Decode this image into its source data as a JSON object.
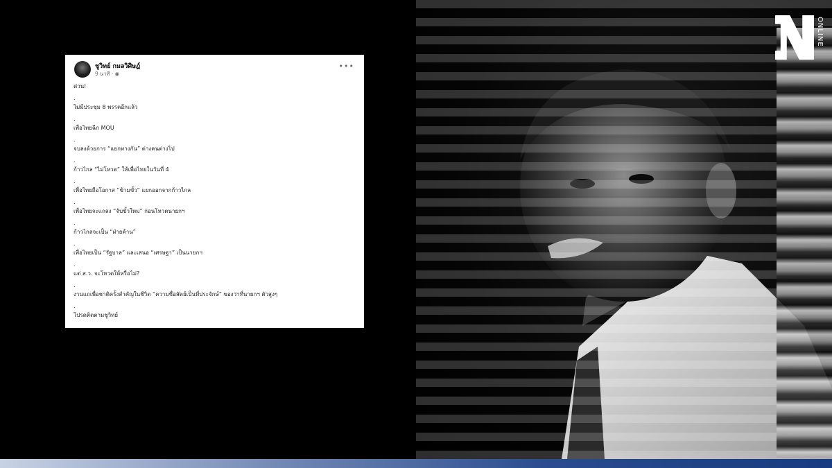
{
  "logo": {
    "brand_letter": "N",
    "brand_text": "ONLINE"
  },
  "post": {
    "author": "ชูวิทย์ กมลวิศิษฏ์",
    "meta": "9 นาที · ",
    "globe_icon": "globe-icon",
    "more_icon": "more-options-icon",
    "separator": ".",
    "lines": [
      "ด่วน!",
      "ไม่มีประชุม 8 พรรคอีกแล้ว",
      "เพื่อไทยฉีก MOU",
      "จบลงด้วยการ “แยกทางกัน” ต่างคนต่างไป",
      "ก้าวไกล “ไม่โหวต” ให้เพื่อไทยในวันที่ 4",
      "เพื่อไทยถือโอกาส “ข้ามขั้ว” แยกออกจากก้าวไกล",
      "เพื่อไทยจะแถลง “จับขั้วใหม่” ก่อนโหวตนายกฯ",
      "ก้าวไกลจะเป็น “ฝ่ายค้าน”",
      "เพื่อไทยเป็น “รัฐบาล” และเสนอ “เศรษฐา” เป็นนายกฯ",
      "แต่ ส.ว. จะโหวตให้หรือไม่?",
      "งานแถเพื่อชาติครั้งสำคัญในชีวิต “ความซื่อสัตย์เป็นที่ประจักษ์” ของว่าที่นายกฯ ตัวสูงๆ",
      "โปรดติดตามชูวิทย์"
    ]
  },
  "colors": {
    "background": "#000000",
    "card": "#ffffff",
    "bar": "#173a80"
  }
}
